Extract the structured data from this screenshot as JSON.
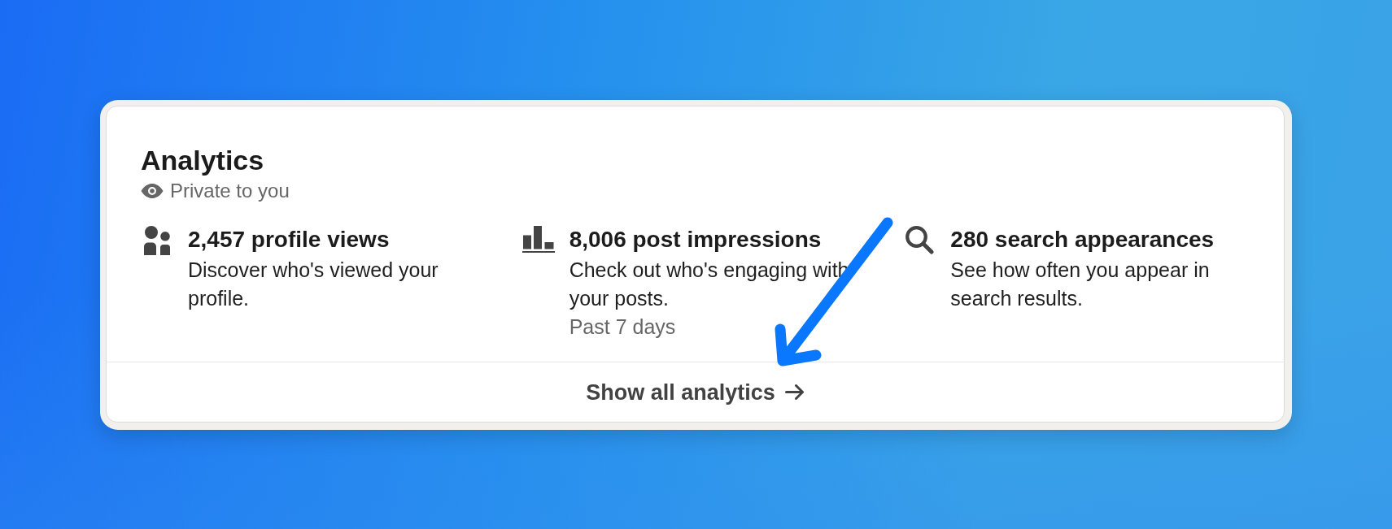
{
  "card": {
    "title": "Analytics",
    "visibility": "Private to you",
    "stats": [
      {
        "kind": "views",
        "headline": "2,457 profile views",
        "description": "Discover who's viewed your profile."
      },
      {
        "kind": "impressions",
        "headline": "8,006 post impressions",
        "description": "Check out who's engaging with your posts.",
        "note": "Past 7 days"
      },
      {
        "kind": "appearances",
        "headline": "280 search appearances",
        "description": "See how often you appear in search results."
      }
    ],
    "footer_link": "Show all analytics"
  }
}
